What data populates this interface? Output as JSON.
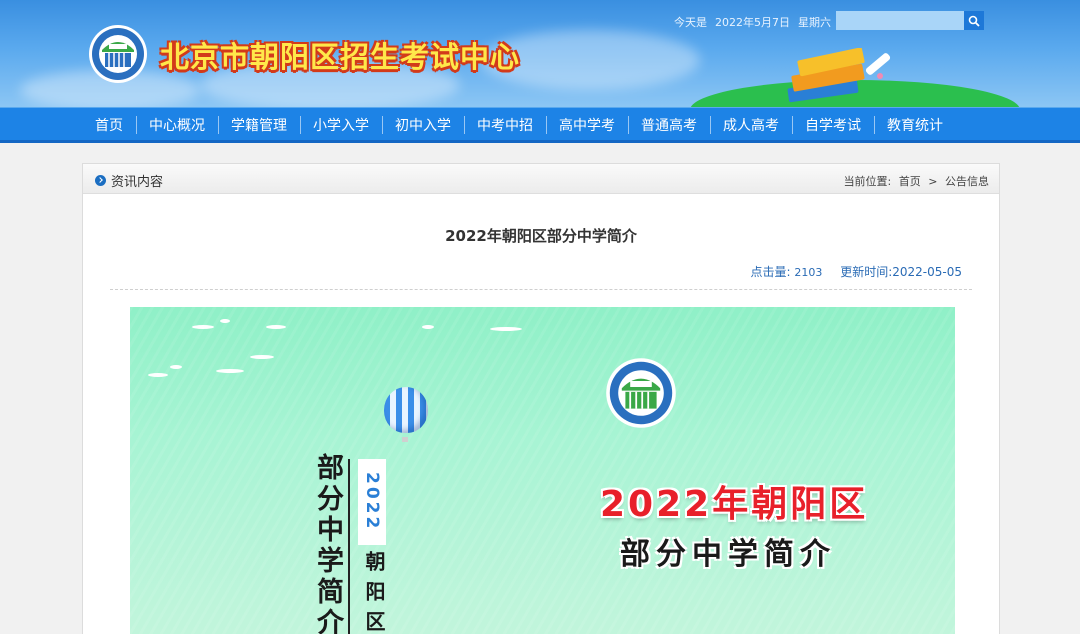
{
  "header": {
    "site_title": "北京市朝阳区招生考试中心",
    "date_prefix": "今天是",
    "date": "2022年5月7日",
    "weekday": "星期六",
    "search_placeholder": ""
  },
  "nav": {
    "items": [
      "首页",
      "中心概况",
      "学籍管理",
      "小学入学",
      "初中入学",
      "中考中招",
      "高中学考",
      "普通高考",
      "成人高考",
      "自学考试",
      "教育统计"
    ]
  },
  "panel": {
    "title": "资讯内容",
    "breadcrumb_label": "当前位置:",
    "breadcrumb_home": "首页",
    "breadcrumb_sep": ">",
    "breadcrumb_current": "公告信息"
  },
  "article": {
    "title": "2022年朝阳区部分中学简介",
    "hits_label": "点击量:",
    "hits_value": "2103",
    "updated_label": "更新时间:",
    "updated_value": "2022-05-05"
  },
  "poster": {
    "year": "2022",
    "vertical_title": "部分中学简介",
    "vertical_district": "朝阳区",
    "headline": "2022年朝阳区",
    "subheadline": "部分中学简介"
  },
  "colors": {
    "header_blue": "#3a8fe0",
    "nav_blue": "#1d83e6",
    "link_blue": "#2a6bb5",
    "title_yellow": "#ffe84a",
    "poster_red": "#e8202a",
    "poster_mint": "#a8f4d4"
  }
}
